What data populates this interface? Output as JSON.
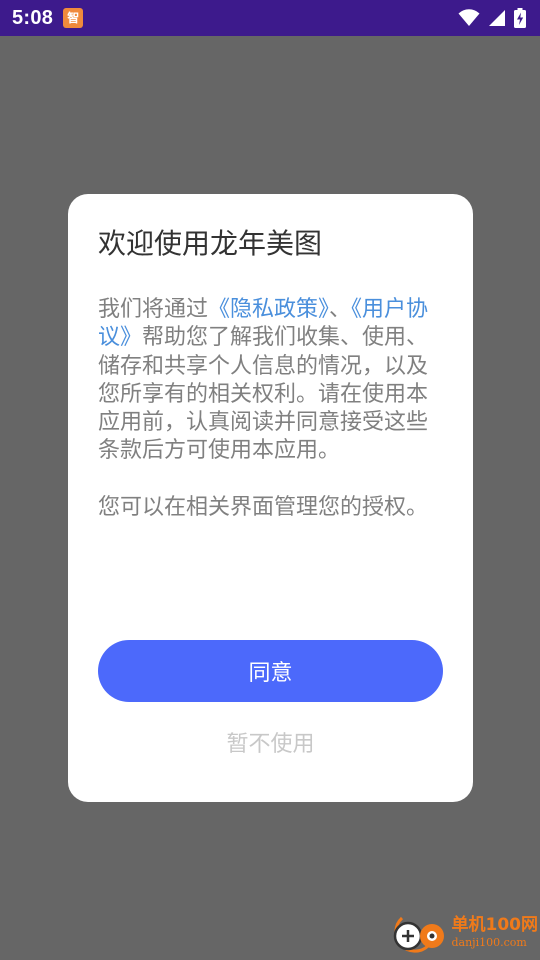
{
  "status_bar": {
    "time": "5:08",
    "notification_icon_text": "智",
    "background_color": "#3d1a8c",
    "icons": [
      "wifi-icon",
      "cell-signal-icon",
      "battery-charging-icon"
    ]
  },
  "dialog": {
    "title": "欢迎使用龙年美图",
    "body": {
      "text_before": "我们将通过",
      "privacy_link": "《隐私政策》",
      "separator": "、",
      "user_agreement_link": "《用户协议》",
      "text_after": "帮助您了解我们收集、使用、储存和共享个人信息的情况，以及您所享有的相关权利。请在使用本应用前，认真阅读并同意接受这些条款后方可使用本应用。",
      "paragraph2": "您可以在相关界面管理您的授权。"
    },
    "agree_label": "同意",
    "decline_label": "暂不使用"
  },
  "watermark": {
    "cn": "单机100网",
    "en": "danji100.com"
  },
  "colors": {
    "overlay": "#666666",
    "primary_button": "#4c69fb",
    "link": "#4a8fdc",
    "body_text": "#808080",
    "title_text": "#333333",
    "decline_text": "#c8c8c8",
    "watermark": "#f07a1a"
  }
}
